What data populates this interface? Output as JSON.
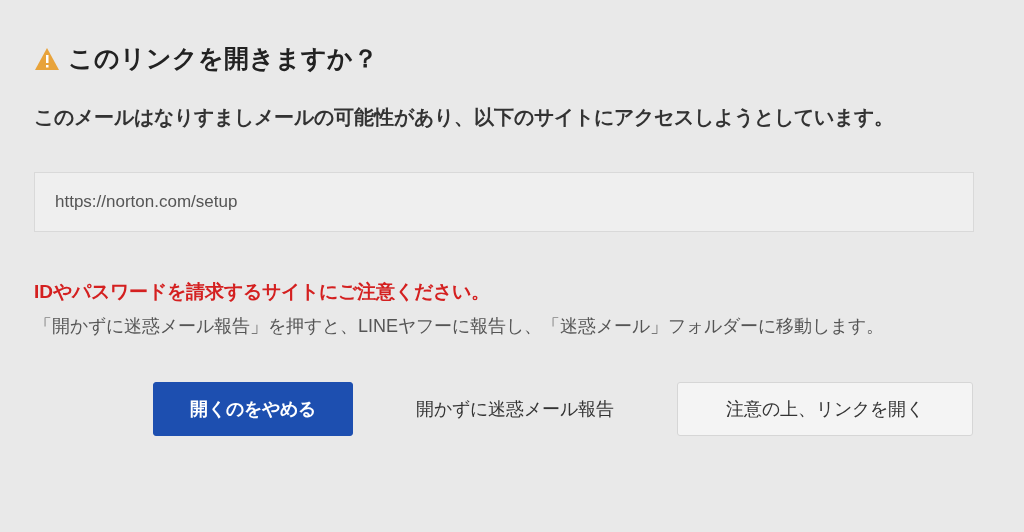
{
  "dialog": {
    "title": "このリンクを開きますか？",
    "message": "このメールはなりすましメールの可能性があり、以下のサイトにアクセスしようとしています。",
    "url_field": {
      "value": "https://norton.com/setup"
    },
    "warning": "IDやパスワードを請求するサイトにご注意ください。",
    "note": "「開かずに迷惑メール報告」を押すと、LINEヤフーに報告し、「迷惑メール」フォルダーに移動します。",
    "buttons": [
      {
        "label": "開くのをやめる",
        "kind": "primary"
      },
      {
        "label": "開かずに迷惑メール報告",
        "kind": "plain"
      },
      {
        "label": "注意の上、リンクを開く",
        "kind": "outlined"
      }
    ]
  }
}
